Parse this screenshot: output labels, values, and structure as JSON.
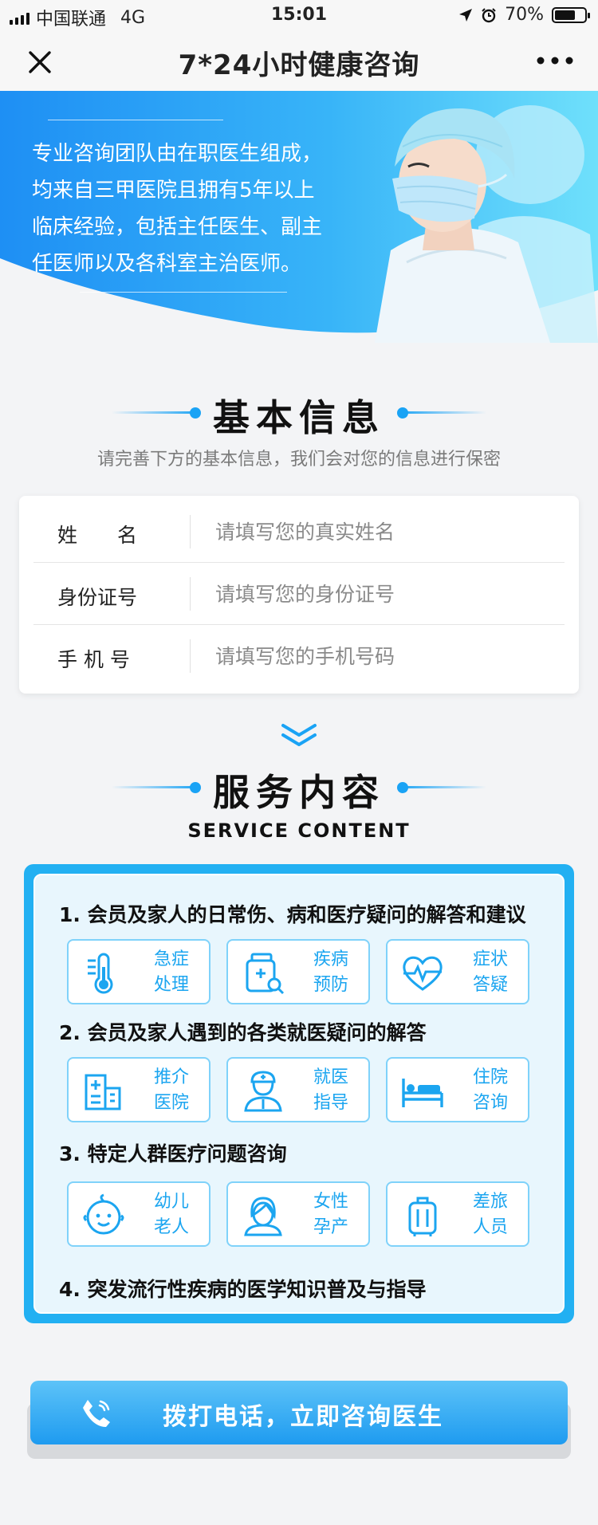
{
  "status_bar": {
    "carrier": "中国联通",
    "network": "4G",
    "time": "15:01",
    "battery_text": "70%",
    "battery_level": 0.7
  },
  "nav": {
    "title": "7*24小时健康咨询"
  },
  "hero": {
    "description": "专业咨询团队由在职医生组成，均来自三甲医院且拥有5年以上临床经验，包括主任医生、副主任医师以及各科室主治医师。"
  },
  "basic_info": {
    "heading": "基本信息",
    "subtitle": "请完善下方的基本信息，我们会对您的信息进行保密",
    "fields": [
      {
        "label": "姓　　名",
        "placeholder": "请填写您的真实姓名",
        "value": ""
      },
      {
        "label": "身份证号",
        "placeholder": "请填写您的身份证号",
        "value": ""
      },
      {
        "label": "手 机 号",
        "placeholder": "请填写您的手机号码",
        "value": ""
      }
    ]
  },
  "service": {
    "heading": "服务内容",
    "subheading": "SERVICE CONTENT",
    "items": [
      {
        "title": "1. 会员及家人的日常伤、病和医疗疑问的解答和建议",
        "tiles": [
          {
            "label": "急症处理",
            "icon": "thermometer-icon"
          },
          {
            "label": "疾病预防",
            "icon": "medicine-bottle-icon"
          },
          {
            "label": "症状答疑",
            "icon": "heartbeat-icon"
          }
        ]
      },
      {
        "title": "2. 会员及家人遇到的各类就医疑问的解答",
        "tiles": [
          {
            "label": "推介医院",
            "icon": "hospital-icon"
          },
          {
            "label": "就医指导",
            "icon": "nurse-icon"
          },
          {
            "label": "住院咨询",
            "icon": "hospital-bed-icon"
          }
        ]
      },
      {
        "title": "3. 特定人群医疗问题咨询",
        "tiles": [
          {
            "label": "幼儿老人",
            "icon": "baby-face-icon"
          },
          {
            "label": "女性孕产",
            "icon": "woman-icon"
          },
          {
            "label": "差旅人员",
            "icon": "luggage-icon"
          }
        ]
      },
      {
        "title": "4. 突发流行性疾病的医学知识普及与指导",
        "tiles": []
      }
    ]
  },
  "call_button": {
    "label": "拨打电话，立即咨询医生"
  },
  "colors": {
    "accent": "#1aa3f5",
    "tile_border": "#7fd2fa",
    "button_top": "#5dc3f8",
    "button_bottom": "#1e9bf0"
  }
}
